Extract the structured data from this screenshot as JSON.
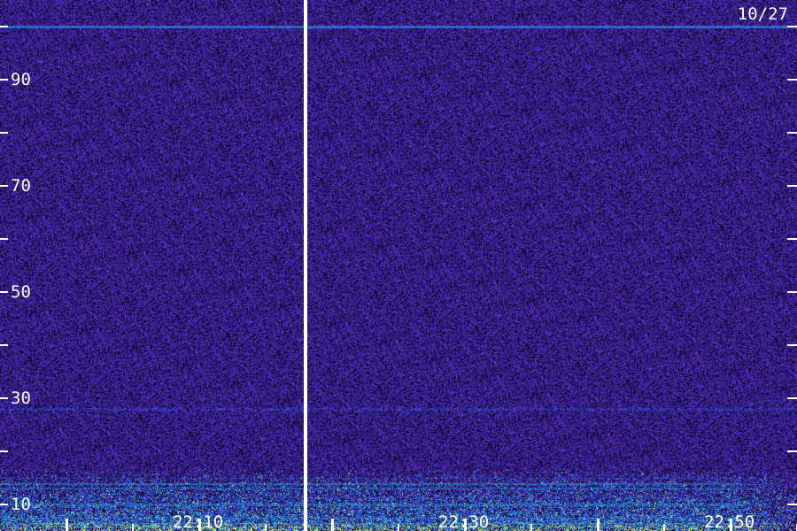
{
  "header": {
    "date": "10/27"
  },
  "y_axis": {
    "labels": [
      {
        "text": "90",
        "value": 90
      },
      {
        "text": "70",
        "value": 70
      },
      {
        "text": "50",
        "value": 50
      },
      {
        "text": "30",
        "value": 30
      },
      {
        "text": "10",
        "value": 10
      }
    ],
    "tick_values": [
      10,
      20,
      30,
      40,
      50,
      60,
      70,
      80,
      90,
      100
    ],
    "range": [
      5,
      105
    ]
  },
  "x_axis": {
    "labels": [
      {
        "text": "22:10",
        "minutes": 10
      },
      {
        "text": "22:30",
        "minutes": 30
      },
      {
        "text": "22:50",
        "minutes": 50
      }
    ],
    "tick_minutes": [
      0,
      5,
      10,
      15,
      20,
      25,
      30,
      35,
      40,
      45,
      50,
      55
    ],
    "range_minutes": [
      -5,
      55
    ]
  },
  "colors": {
    "background": "#1a0a55",
    "noise_low": "#2a1070",
    "noise_high": "#5a3ad0",
    "band_blue": "#2a6bff",
    "band_cyan": "#28d4e0",
    "band_yellow": "#d6f060",
    "marker": "#ffffff"
  }
}
